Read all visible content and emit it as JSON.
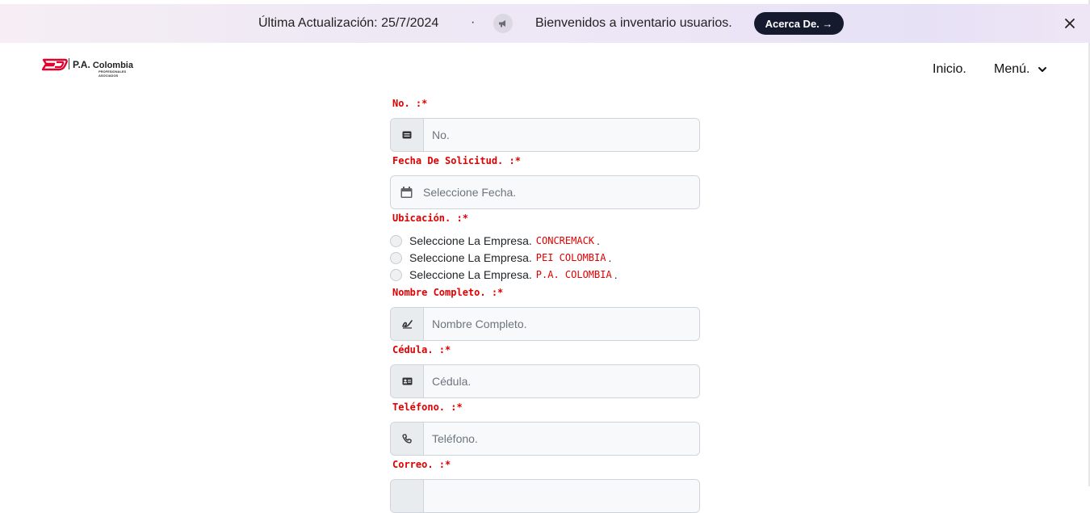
{
  "banner": {
    "last_update": "Última Actualización: 25/7/2024",
    "separator": "·",
    "welcome": "Bienvenidos a inventario usuarios.",
    "about_button": "Acerca De. →"
  },
  "nav": {
    "logo": {
      "name_prefix": "P.A.",
      "name_suffix": "Colombia",
      "tagline_1": "PROFESIONALES",
      "tagline_2": "ASOCIADOS"
    },
    "inicio": "Inicio.",
    "menu": "Menú."
  },
  "form": {
    "no": {
      "label": "No. :*",
      "placeholder": "No."
    },
    "fecha": {
      "label": "Fecha De Solicitud. :*",
      "placeholder": "Seleccione Fecha."
    },
    "ubicacion": {
      "label": "Ubicación. :*",
      "options": [
        {
          "text": "Seleccione La Empresa.",
          "company": "CONCREMACK",
          "suffix": "."
        },
        {
          "text": "Seleccione La Empresa.",
          "company": "PEI COLOMBIA",
          "suffix": "."
        },
        {
          "text": "Seleccione La Empresa.",
          "company": "P.A. COLOMBIA",
          "suffix": "."
        }
      ]
    },
    "nombre": {
      "label": "Nombre Completo. :*",
      "placeholder": "Nombre Completo."
    },
    "cedula": {
      "label": "Cédula. :*",
      "placeholder": "Cédula."
    },
    "telefono": {
      "label": "Teléfono. :*",
      "placeholder": "Teléfono."
    },
    "correo": {
      "label": "Correo. :*"
    }
  },
  "colors": {
    "accent": "#e00000",
    "dark_button": "#161a2e",
    "logo_red": "#e4002b"
  },
  "icons": [
    "megaphone-icon",
    "close-icon",
    "chevron-down-icon",
    "id-card-icon",
    "calendar-icon",
    "signature-icon",
    "address-card-icon",
    "phone-icon"
  ]
}
